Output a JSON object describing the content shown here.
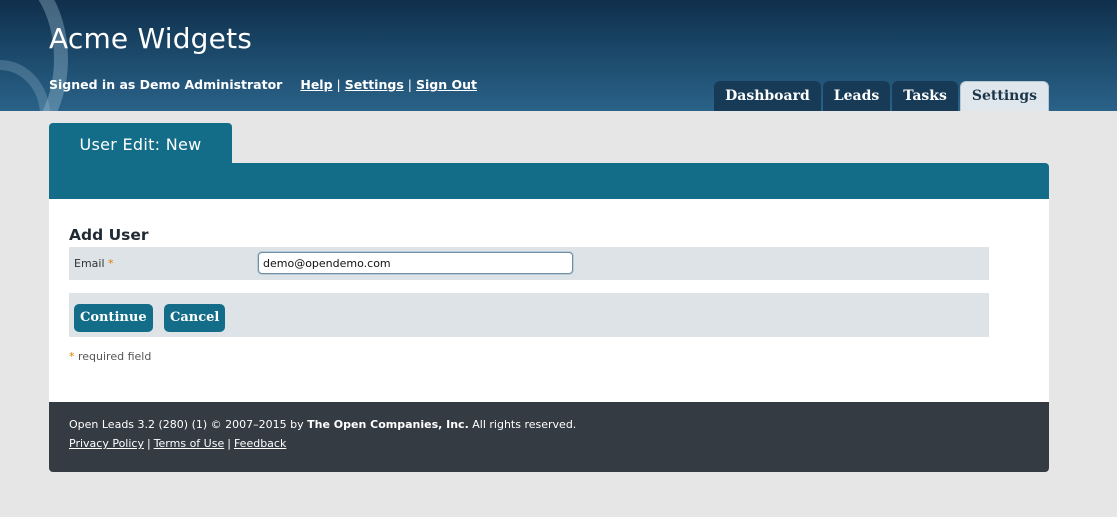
{
  "header": {
    "app_title": "Acme Widgets",
    "signed_in_text": "Signed in as Demo Administrator",
    "links": {
      "help": "Help",
      "settings": "Settings",
      "sign_out": "Sign Out"
    },
    "separator": "|"
  },
  "nav_tabs": [
    {
      "label": "Dashboard",
      "active": false
    },
    {
      "label": "Leads",
      "active": false
    },
    {
      "label": "Tasks",
      "active": false
    },
    {
      "label": "Settings",
      "active": true
    }
  ],
  "panel": {
    "tab_title": "User Edit: New",
    "section_title": "Add User",
    "fields": {
      "email": {
        "label": "Email",
        "required_marker": "*",
        "value": "demo@opendemo.com"
      }
    },
    "buttons": {
      "continue": "Continue",
      "cancel": "Cancel"
    },
    "required_note_marker": "*",
    "required_note": "required field"
  },
  "footer": {
    "product": "Open Leads 3.2 (280) (1) © 2007–2015 by",
    "company": "The Open Companies, Inc.",
    "rights": "All rights reserved.",
    "links": {
      "privacy": "Privacy Policy",
      "terms": "Terms of Use",
      "feedback": "Feedback"
    },
    "separator": "|"
  },
  "colors": {
    "brand_teal": "#136d88",
    "header_dark": "#0f2f4c",
    "footer_dark": "#353b42",
    "required_orange": "#e07b00"
  }
}
